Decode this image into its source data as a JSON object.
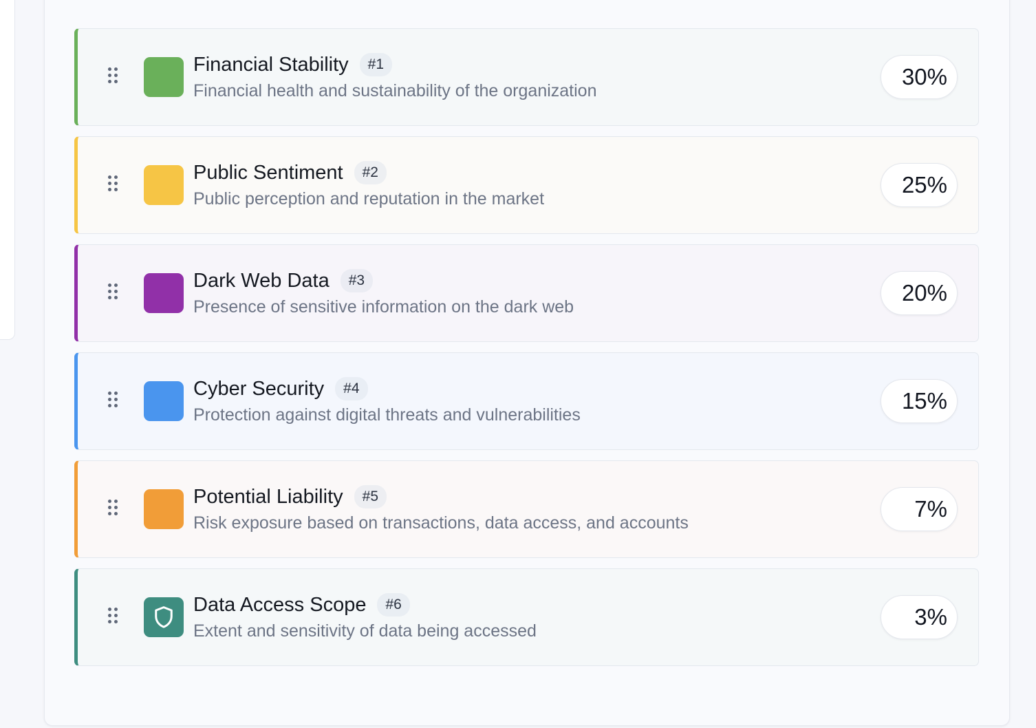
{
  "factors": [
    {
      "title": "Financial Stability",
      "rank": "#1",
      "description": "Financial health and sustainability of the organization",
      "weight": "30%",
      "color": "#6ab05a",
      "bg": "#f5f8f9",
      "icon": "color-swatch"
    },
    {
      "title": "Public Sentiment",
      "rank": "#2",
      "description": "Public perception and reputation in the market",
      "weight": "25%",
      "color": "#f6c545",
      "bg": "#fbfaf8",
      "icon": "color-swatch"
    },
    {
      "title": "Dark Web Data",
      "rank": "#3",
      "description": "Presence of sensitive information on the dark web",
      "weight": "20%",
      "color": "#9130a8",
      "bg": "#f7f5fa",
      "icon": "color-swatch"
    },
    {
      "title": "Cyber Security",
      "rank": "#4",
      "description": "Protection against digital threats and vulnerabilities",
      "weight": "15%",
      "color": "#4a95ee",
      "bg": "#f4f7fd",
      "icon": "color-swatch"
    },
    {
      "title": "Potential Liability",
      "rank": "#5",
      "description": "Risk exposure based on transactions, data access, and accounts",
      "weight": "7%",
      "color": "#f19d38",
      "bg": "#fbf8f8",
      "icon": "color-swatch"
    },
    {
      "title": "Data Access Scope",
      "rank": "#6",
      "description": "Extent and sensitivity of data being accessed",
      "weight": "3%",
      "color": "#3e8d80",
      "bg": "#f5f8f9",
      "icon": "shield-icon"
    }
  ]
}
